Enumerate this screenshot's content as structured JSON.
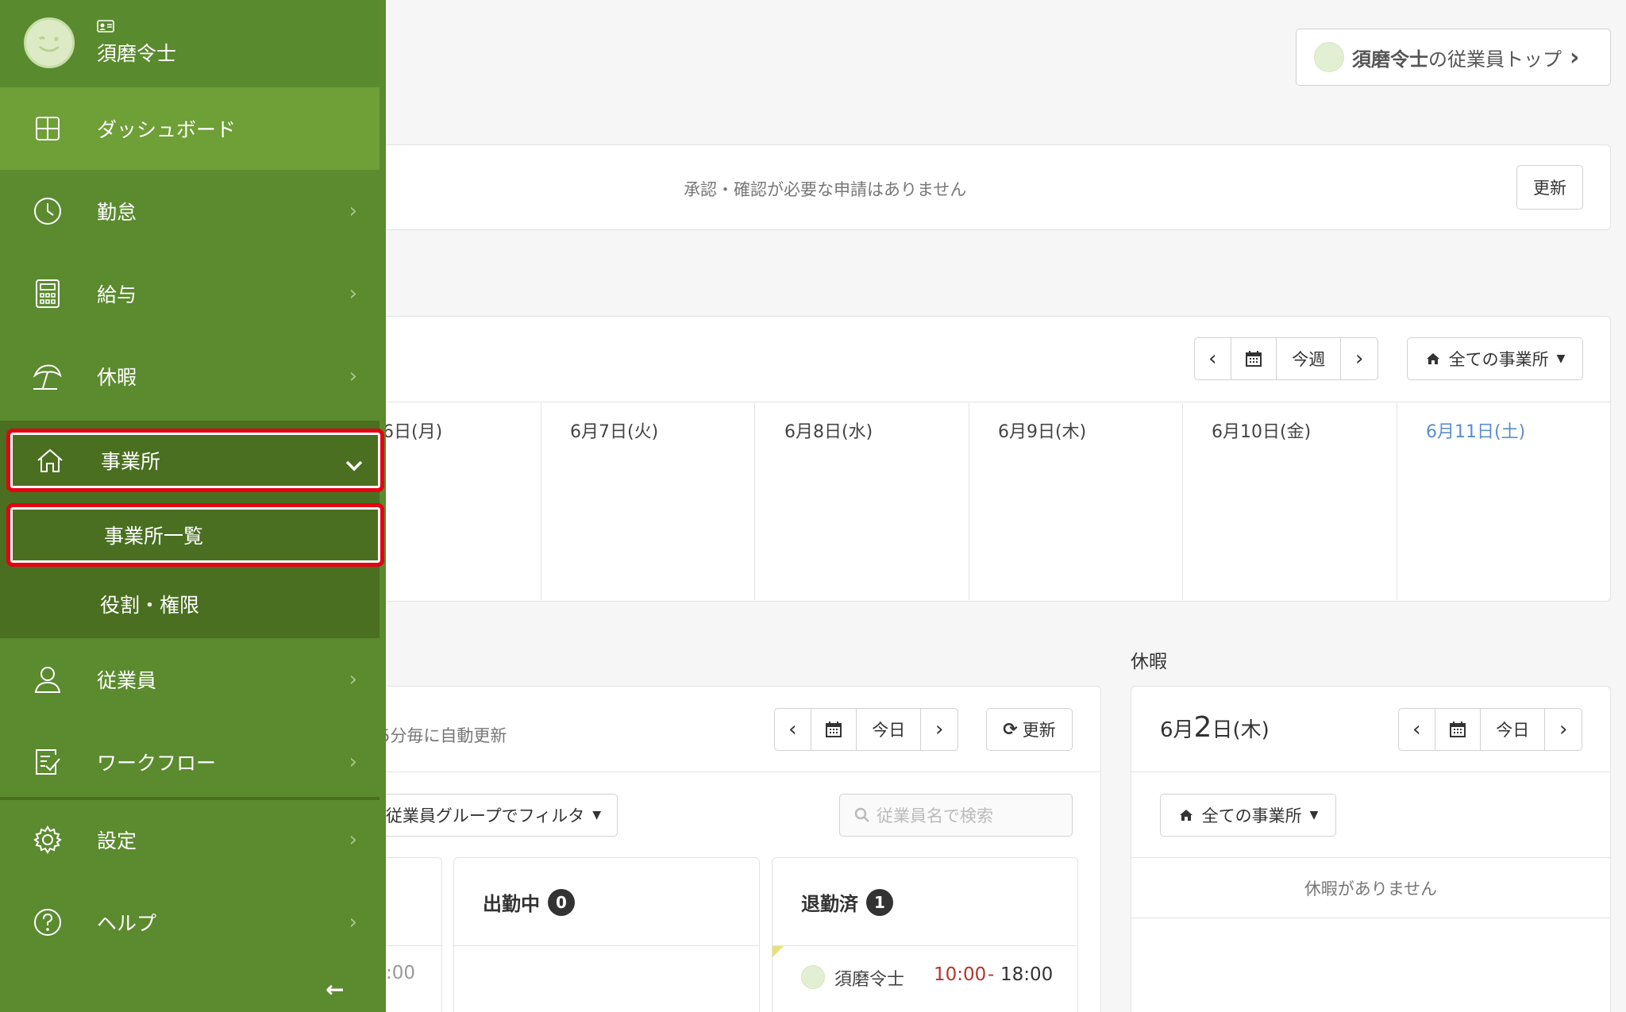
{
  "user": {
    "name": "須磨令士"
  },
  "top_button": {
    "name": "須磨令士",
    "suffix": "の従業員トップ",
    "chevron": "›"
  },
  "notice": {
    "message": "承認・確認が必要な申請はありません",
    "refresh_label": "更新"
  },
  "calendar": {
    "prev": "‹",
    "next": "›",
    "today_label": "今週",
    "office_filter": "全ての事業所",
    "days": [
      {
        "label": "6日(月)",
        "highlight": false
      },
      {
        "label": "6月7日(火)",
        "highlight": false
      },
      {
        "label": "6月8日(水)",
        "highlight": false
      },
      {
        "label": "6月9日(木)",
        "highlight": false
      },
      {
        "label": "6月10日(金)",
        "highlight": false
      },
      {
        "label": "6月11日(土)",
        "highlight": true
      }
    ]
  },
  "attendance": {
    "auto_refresh_text": "5分毎に自動更新",
    "prev": "‹",
    "next": "›",
    "today_label": "今日",
    "refresh_label": "更新",
    "group_filter": "従業員グループでフィルタ",
    "search_placeholder": "従業員名で検索",
    "partial_time": ":00",
    "columns": [
      {
        "title": "出勤中",
        "count": "0"
      },
      {
        "title": "退勤済",
        "count": "1"
      }
    ],
    "done_rows": [
      {
        "name": "須磨令士",
        "start": "10:00",
        "dash": "-",
        "end": "18:00"
      }
    ]
  },
  "leave": {
    "section_title": "休暇",
    "date_month": "6月",
    "date_day": "2",
    "date_suffix": "日(木)",
    "prev": "‹",
    "next": "›",
    "today_label": "今日",
    "office_filter": "全ての事業所",
    "empty_message": "休暇がありません"
  },
  "sidebar": {
    "items": [
      {
        "label": "ダッシュボード",
        "icon": "dashboard-icon"
      },
      {
        "label": "勤怠",
        "icon": "clock-icon"
      },
      {
        "label": "給与",
        "icon": "calculator-icon"
      },
      {
        "label": "休暇",
        "icon": "beach-umbrella-icon"
      },
      {
        "label": "事業所",
        "icon": "home-icon"
      },
      {
        "label": "従業員",
        "icon": "person-icon"
      },
      {
        "label": "ワークフロー",
        "icon": "clipboard-check-icon"
      },
      {
        "label": "設定",
        "icon": "gear-icon"
      },
      {
        "label": "ヘルプ",
        "icon": "help-icon"
      }
    ],
    "sub_items": [
      {
        "label": "事業所一覧"
      },
      {
        "label": "役割・権限"
      }
    ],
    "chevron": "›",
    "collapse_arrow": "←"
  },
  "colors": {
    "sidebar": "#5b8a2f",
    "sidebar_active": "#6f9f37",
    "sidebar_open": "#4a6f21",
    "highlight_box": "#e60012",
    "saturday": "#5b8fc9",
    "time_red": "#b5342a"
  }
}
